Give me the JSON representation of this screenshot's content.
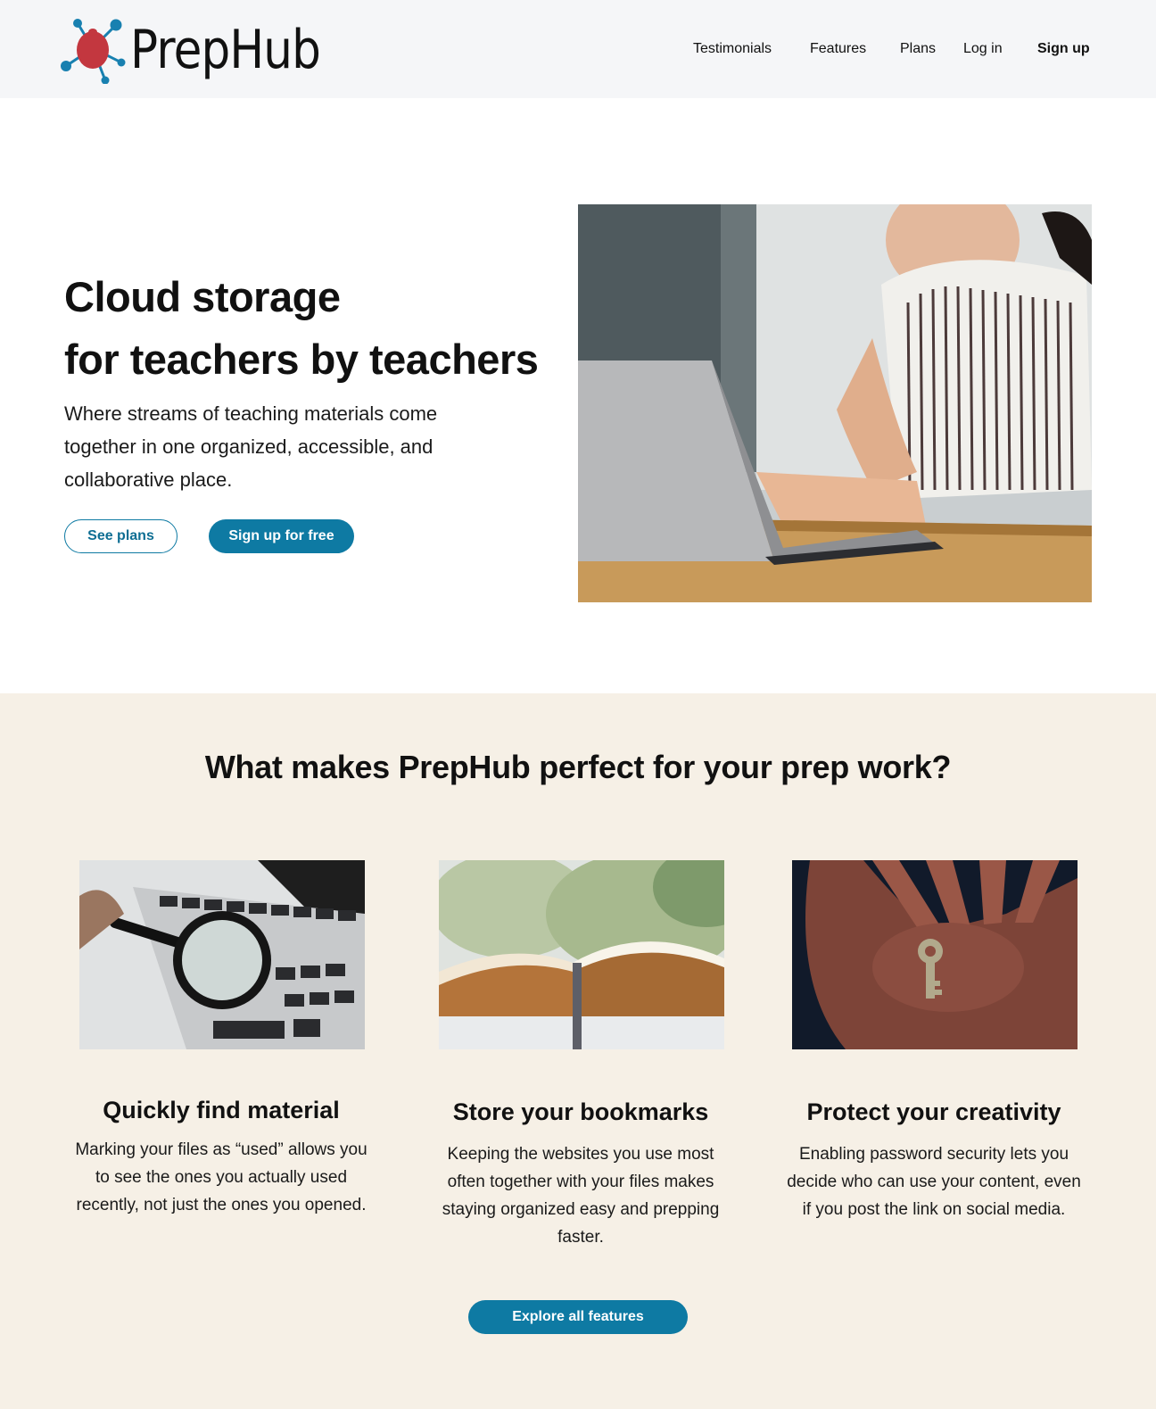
{
  "brand": {
    "name": "PrepHub",
    "logo_color": "#c3373f",
    "accent_color": "#0e7aa3",
    "node_color": "#1880b0"
  },
  "nav": {
    "testimonials": "Testimonials",
    "features": "Features",
    "plans": "Plans",
    "login": "Log in",
    "signup": "Sign up"
  },
  "hero": {
    "title_line1": "Cloud storage",
    "title_line2": "for teachers by teachers",
    "subtitle": "Where streams of teaching materials come together in one organized, accessible, and collaborative place.",
    "btn_plans": "See plans",
    "btn_signup": "Sign up for free"
  },
  "features": {
    "title": "What makes PrepHub perfect for your prep work?",
    "cards": [
      {
        "title": "Quickly find material",
        "text": "Marking your files as “used” allows you to see the ones you actually used recently, not just the ones you opened."
      },
      {
        "title": "Store your bookmarks",
        "text": "Keeping the websites you use most often together with your files makes staying organized easy and prepping faster."
      },
      {
        "title": "Protect your creativity",
        "text": "Enabling password security lets you decide who can use your content, even if you post the link on social media."
      }
    ],
    "btn_explore": "Explore all features"
  }
}
